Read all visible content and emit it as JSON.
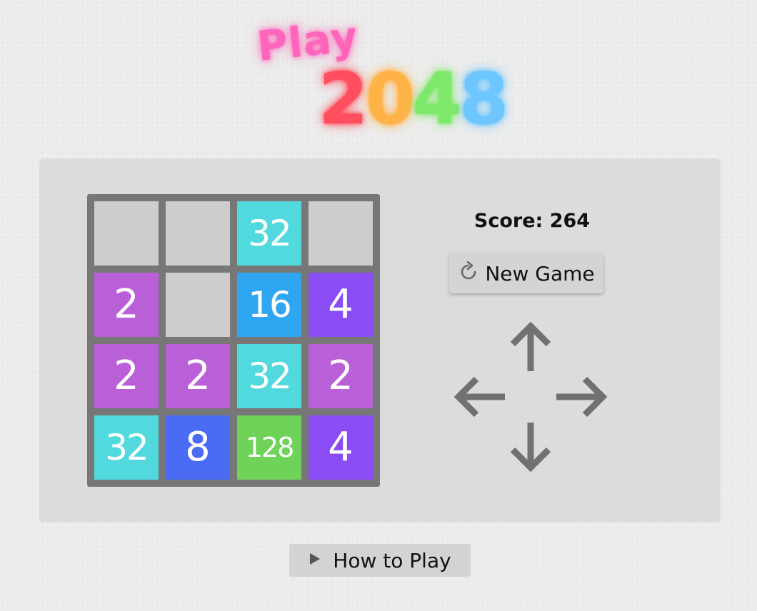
{
  "logo": {
    "play": "Play",
    "digits": [
      {
        "char": "2",
        "color": "#ff4f5e"
      },
      {
        "char": "0",
        "color": "#ffb347"
      },
      {
        "char": "4",
        "color": "#7de86a"
      },
      {
        "char": "8",
        "color": "#6ec6ff"
      }
    ],
    "play_color": "#ff66bb"
  },
  "board": {
    "tiles": [
      [
        "",
        "",
        "32",
        ""
      ],
      [
        "2",
        "",
        "16",
        "4"
      ],
      [
        "2",
        "2",
        "32",
        "2"
      ],
      [
        "32",
        "8",
        "128",
        "4"
      ]
    ],
    "colors": {
      "empty": "#cdcdcd",
      "2": "#b95fd7",
      "4": "#8a4cf5",
      "8": "#4a6cf5",
      "16": "#2fa6f2",
      "32": "#52d9dd",
      "128": "#6fd259"
    },
    "border_color": "#777777"
  },
  "score": {
    "label": "Score:",
    "value": "264"
  },
  "controls": {
    "new_game_label": "New Game",
    "new_game_icon": "refresh-icon",
    "arrows": [
      "arrow-up-icon",
      "arrow-left-icon",
      "arrow-right-icon",
      "arrow-down-icon"
    ]
  },
  "how_to_play": {
    "label": "How to Play",
    "icon": "play-triangle-icon"
  }
}
